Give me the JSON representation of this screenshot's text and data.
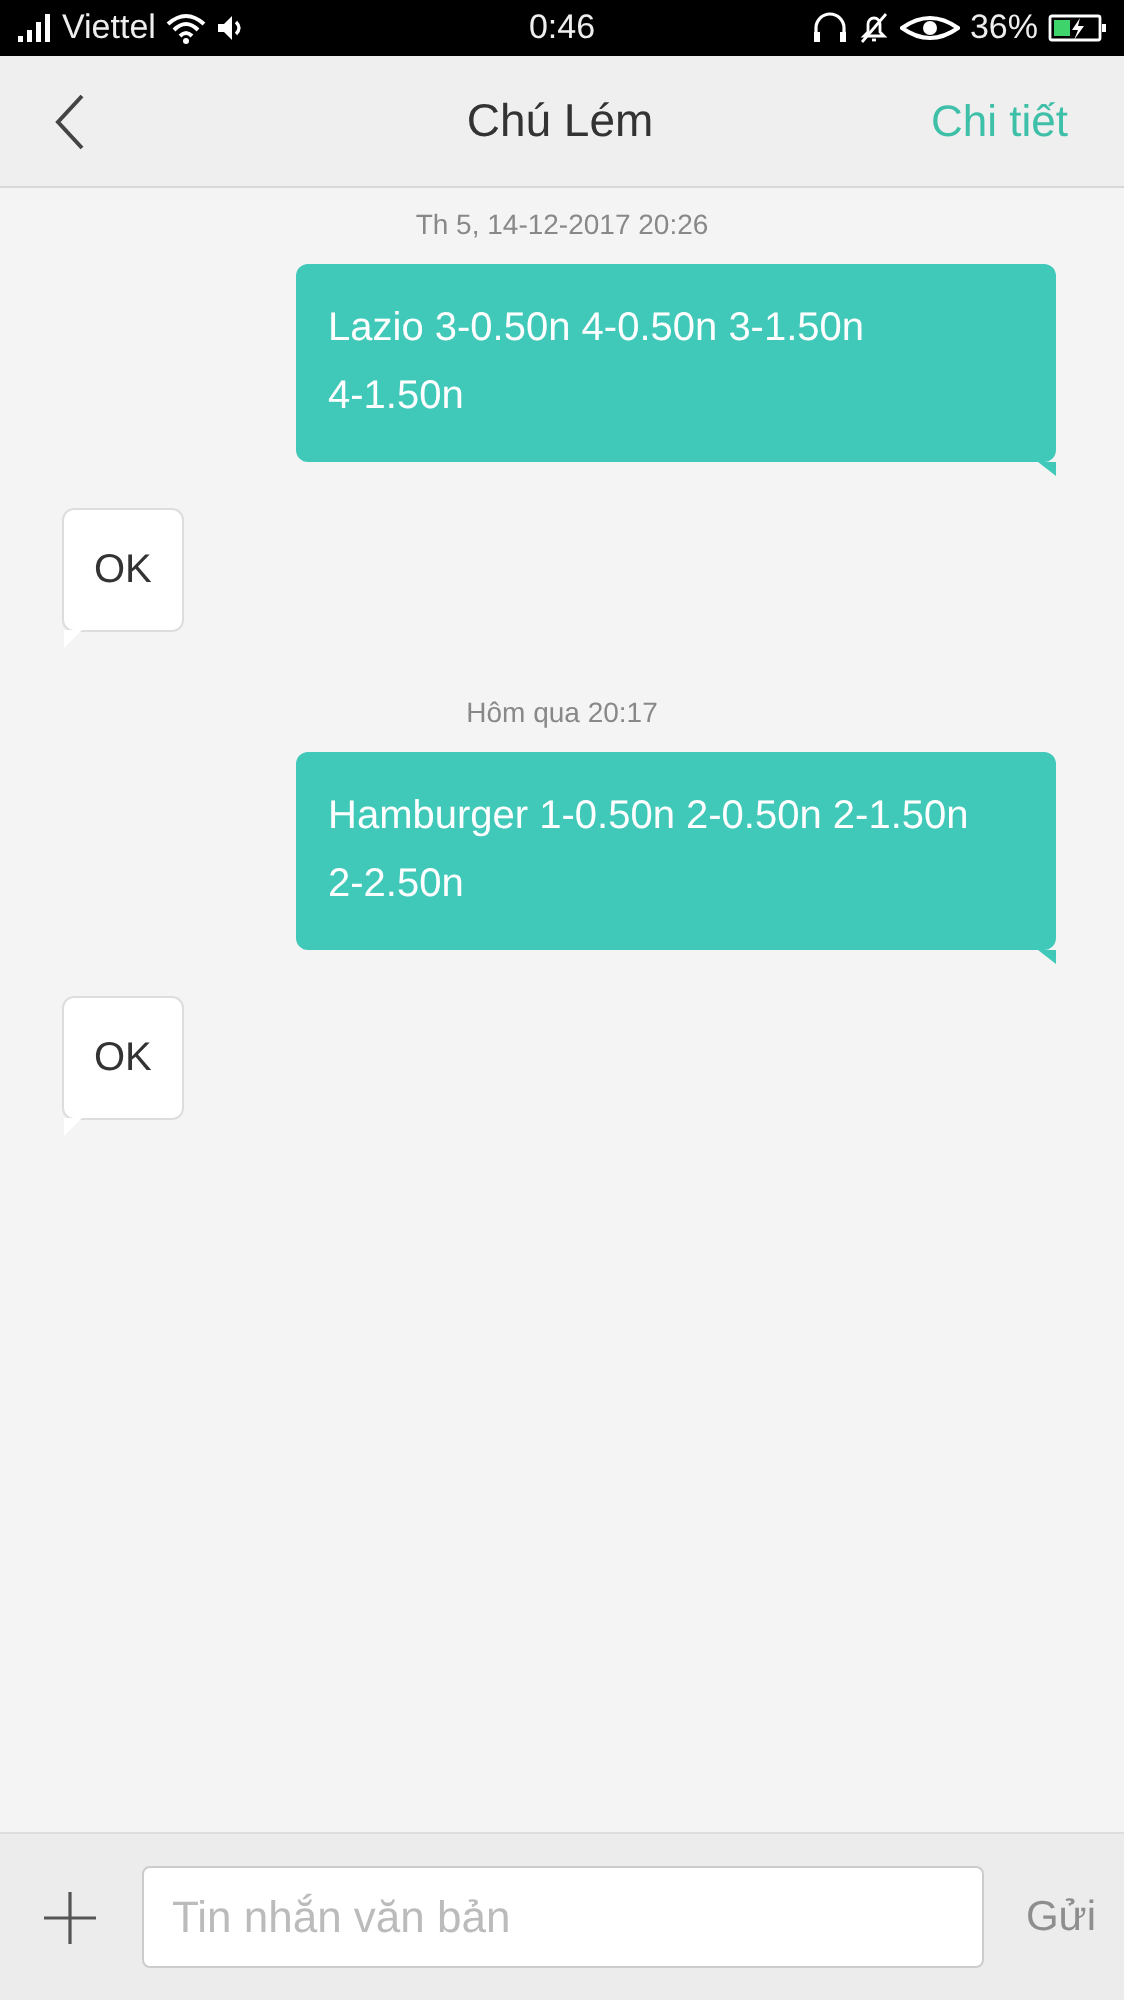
{
  "status_bar": {
    "carrier": "Viettel",
    "time": "0:46",
    "battery": "36%"
  },
  "header": {
    "back": true,
    "title": "Chú Lém",
    "action": "Chi tiết"
  },
  "messages": [
    {
      "kind": "timestamp",
      "text": "Th 5, 14-12-2017  20:26"
    },
    {
      "kind": "sent",
      "text": "Lazio 3-0.50n 4-0.50n 3-1.50n 4-1.50n"
    },
    {
      "kind": "received",
      "text": "OK"
    },
    {
      "kind": "timestamp",
      "text": "Hôm qua  20:17"
    },
    {
      "kind": "sent",
      "text": "Hamburger 1-0.50n 2-0.50n 2-1.50n 2-2.50n"
    },
    {
      "kind": "received",
      "text": "OK"
    }
  ],
  "composer": {
    "placeholder": "Tin nhắn văn bản",
    "send": "Gửi",
    "send_disabled": true
  }
}
